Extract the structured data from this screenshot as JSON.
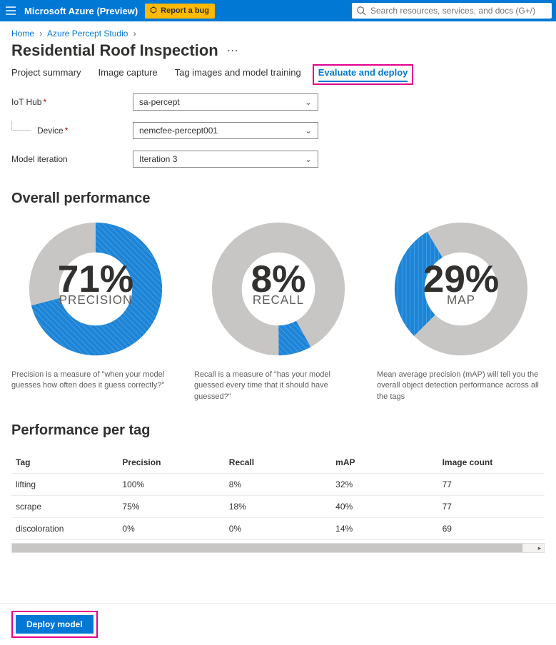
{
  "header": {
    "brand": "Microsoft Azure (Preview)",
    "bug_label": "Report a bug",
    "search_placeholder": "Search resources, services, and docs (G+/)"
  },
  "breadcrumb": {
    "items": [
      "Home",
      "Azure Percept Studio"
    ]
  },
  "page": {
    "title": "Residential Roof Inspection"
  },
  "tabs": {
    "items": [
      {
        "label": "Project summary",
        "active": false
      },
      {
        "label": "Image capture",
        "active": false
      },
      {
        "label": "Tag images and model training",
        "active": false
      },
      {
        "label": "Evaluate and deploy",
        "active": true
      }
    ]
  },
  "form": {
    "iot_hub_label": "IoT Hub",
    "iot_hub_value": "sa-percept",
    "device_label": "Device",
    "device_value": "nemcfee-percept001",
    "iteration_label": "Model iteration",
    "iteration_value": "Iteration 3"
  },
  "overall": {
    "heading": "Overall performance",
    "metrics": [
      {
        "value": 71,
        "display": "71%",
        "label": "PRECISION",
        "desc": "Precision is a measure of \"when your model guesses how often does it guess correctly?\""
      },
      {
        "value": 8,
        "display": "8%",
        "label": "RECALL",
        "desc": "Recall is a measure of \"has your model guessed every time that it should have guessed?\""
      },
      {
        "value": 29,
        "display": "29%",
        "label": "MAP",
        "desc": "Mean average precision (mAP) will tell you the overall object detection performance across all the tags"
      }
    ]
  },
  "pertag": {
    "heading": "Performance per tag",
    "columns": [
      "Tag",
      "Precision",
      "Recall",
      "mAP",
      "Image count"
    ],
    "rows": [
      {
        "tag": "lifting",
        "precision": "100%",
        "recall": "8%",
        "map": "32%",
        "count": "77"
      },
      {
        "tag": "scrape",
        "precision": "75%",
        "recall": "18%",
        "map": "40%",
        "count": "77"
      },
      {
        "tag": "discoloration",
        "precision": "0%",
        "recall": "0%",
        "map": "14%",
        "count": "69"
      }
    ]
  },
  "footer": {
    "deploy_label": "Deploy model"
  },
  "chart_data": [
    {
      "type": "pie",
      "title": "Precision",
      "slices": [
        {
          "name": "value",
          "value": 71
        },
        {
          "name": "rest",
          "value": 29
        }
      ]
    },
    {
      "type": "pie",
      "title": "Recall",
      "slices": [
        {
          "name": "value",
          "value": 8
        },
        {
          "name": "rest",
          "value": 92
        }
      ]
    },
    {
      "type": "pie",
      "title": "mAP",
      "slices": [
        {
          "name": "value",
          "value": 29
        },
        {
          "name": "rest",
          "value": 71
        }
      ]
    }
  ],
  "colors": {
    "accent": "#0078d4",
    "track": "#c8c6c4",
    "highlight": "#e3008c",
    "warn": "#ffb900"
  }
}
